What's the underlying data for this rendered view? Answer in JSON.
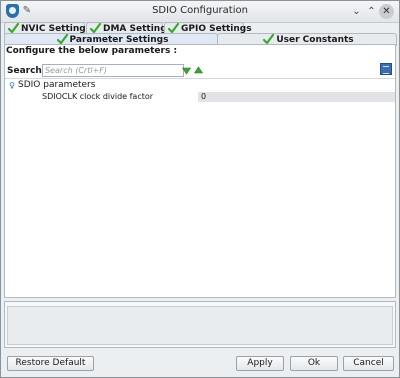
{
  "window": {
    "title": "SDIO Configuration",
    "icons": [
      "app-shield-icon",
      "pin-icon",
      "chevron-down-icon",
      "chevron-up-icon",
      "close-icon"
    ]
  },
  "tabs_row1": [
    {
      "label": "NVIC Settings",
      "icon": "check-icon"
    },
    {
      "label": "DMA Settings",
      "icon": "check-icon"
    },
    {
      "label": "GPIO Settings",
      "icon": "check-icon"
    }
  ],
  "tabs_row2": [
    {
      "label": "Parameter Settings",
      "icon": "check-icon",
      "active": true
    },
    {
      "label": "User Constants",
      "icon": "check-icon",
      "active": false
    }
  ],
  "panel": {
    "instruction": "Configure the below parameters :",
    "search": {
      "label": "Search :",
      "placeholder": "Search (Crtl+F)",
      "value": ""
    },
    "group": {
      "label": "SDIO parameters",
      "expanded": true
    },
    "parameters": [
      {
        "name": "SDIOCLK clock divide factor",
        "value": "0"
      }
    ]
  },
  "buttons": {
    "restore_default": "Restore Default",
    "apply": "Apply",
    "ok": "Ok",
    "cancel": "Cancel"
  },
  "colors": {
    "check_green": "#3aa832",
    "accent_blue": "#2e6fa8",
    "value_cell_bg": "#e1e3e6"
  }
}
